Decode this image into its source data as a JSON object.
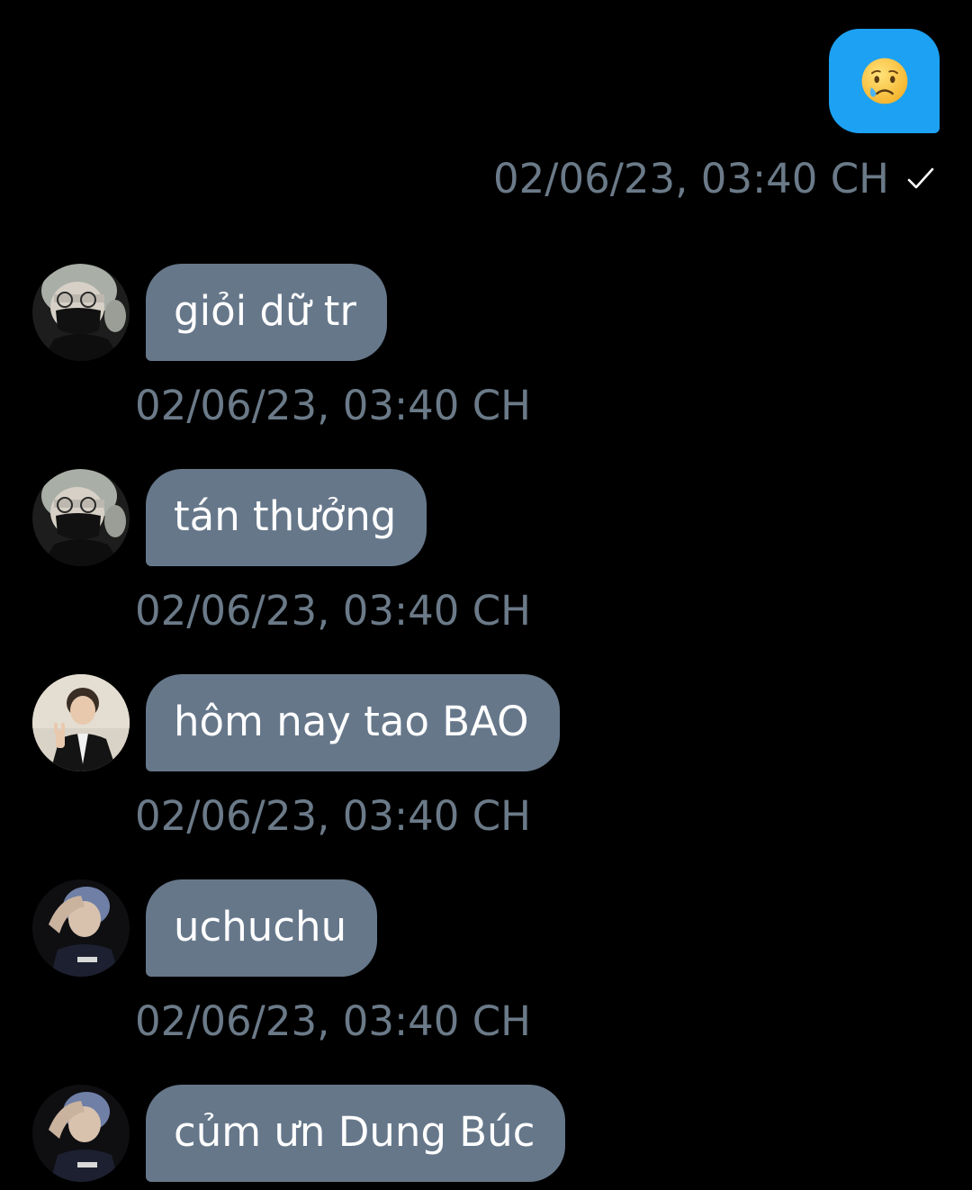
{
  "sent_message": {
    "emoji": "crying-face-emoji",
    "timestamp": "02/06/23, 03:40 CH",
    "status_icon": "check-icon"
  },
  "received_messages": [
    {
      "text": "giỏi dữ tr",
      "timestamp": "02/06/23, 03:40 CH",
      "avatar": "avatar-user-a"
    },
    {
      "text": "tán thưởng",
      "timestamp": "02/06/23, 03:40 CH",
      "avatar": "avatar-user-a"
    },
    {
      "text": "hôm nay tao BAO",
      "timestamp": "02/06/23, 03:40 CH",
      "avatar": "avatar-user-b"
    },
    {
      "text": "uchuchu",
      "timestamp": "02/06/23, 03:40 CH",
      "avatar": "avatar-user-c"
    },
    {
      "text": "củm ưn Dung Búc",
      "timestamp": "",
      "avatar": "avatar-user-c"
    }
  ],
  "colors": {
    "background": "#000000",
    "sent_bubble": "#1da1f2",
    "received_bubble": "#66778a",
    "timestamp_text": "#6b7a88",
    "message_text": "#ffffff"
  }
}
